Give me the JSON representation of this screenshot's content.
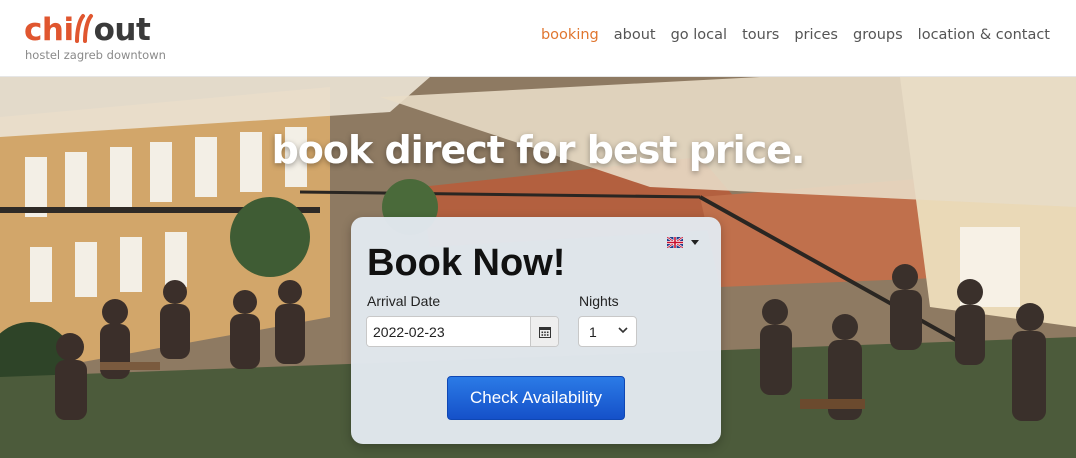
{
  "header": {
    "logo": {
      "text_left": "chi",
      "text_right": "out",
      "subtitle": "hostel zagreb downtown"
    },
    "nav": [
      {
        "label": "booking",
        "active": true
      },
      {
        "label": "about"
      },
      {
        "label": "go local"
      },
      {
        "label": "tours"
      },
      {
        "label": "prices"
      },
      {
        "label": "groups"
      },
      {
        "label": "location & contact"
      }
    ]
  },
  "hero": {
    "title": "book direct for best price."
  },
  "widget": {
    "title": "Book Now!",
    "language_icon": "uk-flag-icon",
    "arrival_label": "Arrival Date",
    "arrival_value": "2022-02-23",
    "nights_label": "Nights",
    "nights_value": "1",
    "cta_label": "Check Availability"
  },
  "colors": {
    "brand": "#e0562f",
    "nav_active": "#e0762f",
    "cta": "#1a5fd6"
  }
}
